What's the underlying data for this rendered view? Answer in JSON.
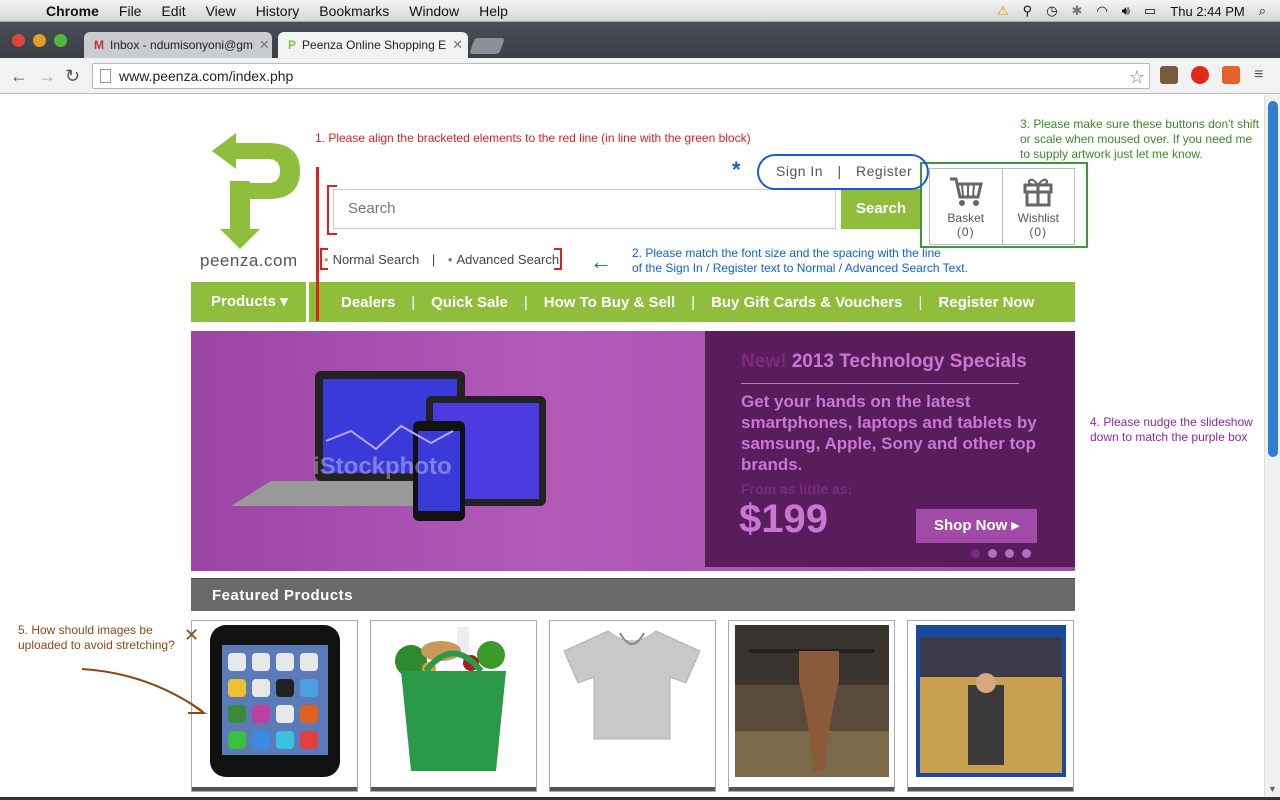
{
  "menubar": {
    "app_name": "Chrome",
    "items": [
      "File",
      "Edit",
      "View",
      "History",
      "Bookmarks",
      "Window",
      "Help"
    ],
    "clock": "Thu 2:44 PM"
  },
  "tabs": [
    {
      "title": "Inbox - ndumisonyoni@gm",
      "active": false
    },
    {
      "title": "Peenza Online Shopping E",
      "active": true
    }
  ],
  "toolbar": {
    "url": "www.peenza.com/index.php"
  },
  "site": {
    "logo_text": "peenza.com",
    "sign_in": "Sign In",
    "sign_sep": "|",
    "register": "Register",
    "search_placeholder": "Search",
    "search_button": "Search",
    "basket_label": "Basket",
    "basket_count": "(0)",
    "wishlist_label": "Wishlist",
    "wishlist_count": "(0)",
    "normal_search": "Normal Search",
    "mode_sep": "|",
    "advanced_search": "Advanced Search",
    "nav": {
      "products": "Products ▾",
      "items": [
        "Dealers",
        "Quick Sale",
        "How To Buy & Sell",
        "Buy Gift Cards & Vouchers",
        "Register Now"
      ],
      "sep": "|"
    },
    "slide": {
      "new": "New!",
      "headline": "2013 Technology Specials",
      "description": "Get your hands on the latest smartphones, laptops and tablets by samsung, Apple, Sony and other top brands.",
      "from": "From as little as:",
      "price": "$199",
      "shop_now": "Shop Now ▸",
      "watermark": "iStockphoto"
    },
    "featured_title": "Featured Products"
  },
  "annotations": {
    "a1": "1. Please align the bracketed elements to the red line (in line with the green block)",
    "a2_line1": "2. Please match the font size and the spacing with the line",
    "a2_line2": "of the Sign In / Register text to Normal / Advanced Search Text.",
    "a3_line1": "3. Please make sure these buttons don't shift",
    "a3_line2": "or scale when moused over. If you need me",
    "a3_line3": "to supply artwork just let me know.",
    "a4_line1": "4. Please nudge the slideshow",
    "a4_line2": "down to match the purple box",
    "a5_line1": "5. How should images be",
    "a5_line2": "uploaded to avoid stretching?"
  },
  "colors": {
    "brand_green": "#8fbe3c",
    "purple": "#a24aa8",
    "dark_purple": "#5a1d5c"
  }
}
